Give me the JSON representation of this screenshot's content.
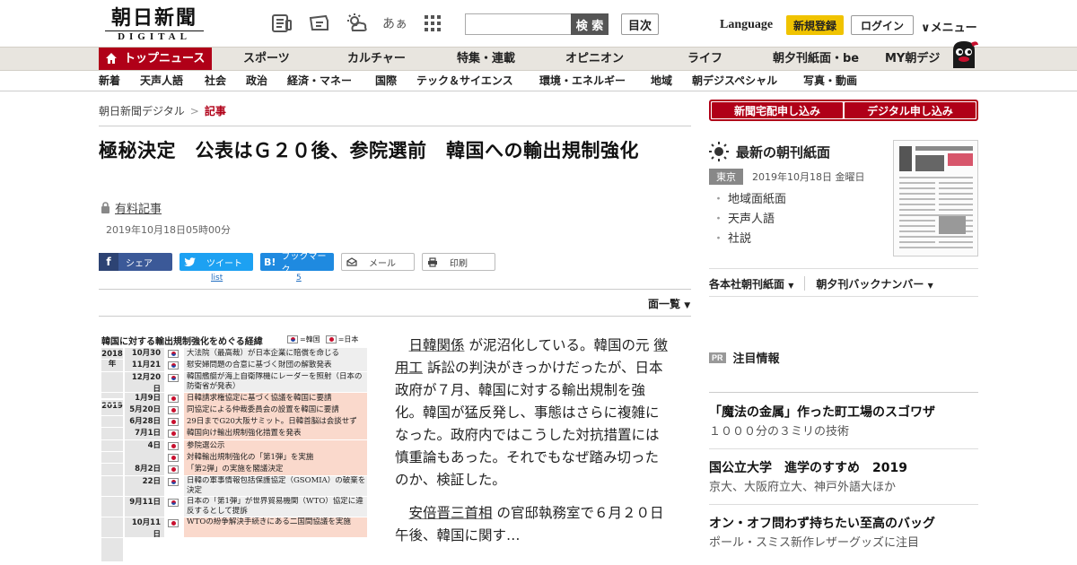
{
  "header": {
    "logo_kanji": "朝日新聞",
    "logo_sub": "DIGITAL",
    "font_size_glyph": "あぁ",
    "search_placeholder": "",
    "search_button": "検 索",
    "mokuji_button": "目次",
    "language": "Language",
    "signup": "新規登録",
    "login": "ログイン",
    "menu": "メニュー"
  },
  "nav_primary": {
    "top_news": "トップニュース",
    "items": [
      "スポーツ",
      "カルチャー",
      "特集・連載",
      "オピニオン",
      "ライフ",
      "朝夕刊紙面・be",
      "MY朝デジ"
    ]
  },
  "nav_secondary": {
    "items": [
      "新着",
      "天声人語",
      "社会",
      "政治",
      "経済・マネー",
      "国際",
      "テック＆サイエンス",
      "環境・エネルギー",
      "地域",
      "朝デジスペシャル",
      "写真・動画"
    ]
  },
  "breadcrumb": {
    "home": "朝日新聞デジタル",
    "sep": ">",
    "current": "記事"
  },
  "article": {
    "title": "極秘決定　公表はＧ２０後、参院選前　韓国への輸出規制強化",
    "paid_label": "有料記事",
    "date": "2019年10月18日05時00分",
    "share": {
      "facebook": "シェア",
      "twitter": "ツイート",
      "twitter_count": "list",
      "hatena": "ブックマーク",
      "hatena_count": "5",
      "mail": "メール",
      "print": "印刷"
    },
    "menlist": "面一覧",
    "body": {
      "p1_kw1": "日韓関係",
      "p1_a": " が泥沼化している。韓国の元 ",
      "p1_kw2": "徴用工",
      "p1_b": " 訴訟の判決がきっかけだったが、日本政府が７月、韓国に対する輸出規制を強化。韓国が猛反発し、事態はさらに複雑になった。政府内ではこうした対抗措置には慎重論もあった。それでもなぜ踏み切ったのか、検証した。",
      "p2_kw1": "安倍晋三首相",
      "p2_a": " の官邸執務室で６月２０日午後、韓国に関す…"
    }
  },
  "figure": {
    "title": "韓国に対する輸出規制強化をめぐる経緯",
    "legend_kr": "=韓国",
    "legend_jp": "=日本",
    "year_2018": "2018年",
    "year_2019": "2019",
    "rows": [
      {
        "md": "10月30日",
        "flag": "kr",
        "ev": "大法院（最高裁）が日本企業に賠償を命じる"
      },
      {
        "md": "11月21日",
        "flag": "kr",
        "ev": "慰安婦問題の合意に基づく財団の解散発表"
      },
      {
        "md": "12月20日",
        "flag": "kr",
        "ev": "韓国艦艇が海上自衛隊機にレーダーを照射（日本の防衛省が発表）"
      },
      {
        "md": "1月9日",
        "flag": "jp",
        "ev": "日韓請求権協定に基づく協議を韓国に要請"
      },
      {
        "md": "5月20日",
        "flag": "jp",
        "ev": "同協定による仲裁委員会の設置を韓国に要請"
      },
      {
        "md": "6月28日",
        "flag": "jp",
        "ev": "29日までG20大阪サミット。日韓首脳は会談せず"
      },
      {
        "md": "7月1日",
        "flag": "jp",
        "ev": "韓国向け輸出規制強化措置を発表"
      },
      {
        "md": "4日",
        "flag": "jp",
        "ev": "参院選公示"
      },
      {
        "md": "",
        "flag": "jp",
        "ev": "対韓輸出規制強化の「第1弾」を実施"
      },
      {
        "md": "8月2日",
        "flag": "jp",
        "ev": "「第2弾」の実施を閣議決定"
      },
      {
        "md": "22日",
        "flag": "kr",
        "ev": "日韓の軍事情報包括保護協定（GSOMIA）の破棄を決定"
      },
      {
        "md": "9月11日",
        "flag": "kr",
        "ev": "日本の「第1弾」が世界貿易機関（WTO）協定に違反するとして提訴"
      },
      {
        "md": "10月11日",
        "flag": "jp",
        "ev": "WTOの紛争解決手続きにある二国間協議を実施"
      }
    ]
  },
  "sidebar": {
    "subscribe_home": "新聞宅配申し込み",
    "subscribe_digital": "デジタル申し込み",
    "paper_title": "最新の朝刊紙面",
    "paper_region": "東京",
    "paper_date": "2019年10月18日 金曜日",
    "paper_list": [
      "地域面紙面",
      "天声人語",
      "社説"
    ],
    "link_regional": "各本社朝刊紙面",
    "link_backnumber": "朝夕刊バックナンバー",
    "pr_badge": "PR",
    "pr_title": "注目情報",
    "promos": [
      {
        "title": "「魔法の金属」作った町工場のスゴワザ",
        "sub": "１０００分の３ミリの技術"
      },
      {
        "title": "国公立大学　進学のすすめ　2019",
        "sub": "京大、大阪府立大、神戸外語大ほか"
      },
      {
        "title": "オン・オフ問わず持ちたい至高のバッグ",
        "sub": "ポール・スミス新作レザーグッズに注目"
      }
    ]
  },
  "colors": {
    "brand_red": "#b00018",
    "signup_yellow": "#f0c300",
    "facebook": "#3b5998",
    "twitter": "#1da1f2",
    "hatena": "#1f8ae0"
  }
}
